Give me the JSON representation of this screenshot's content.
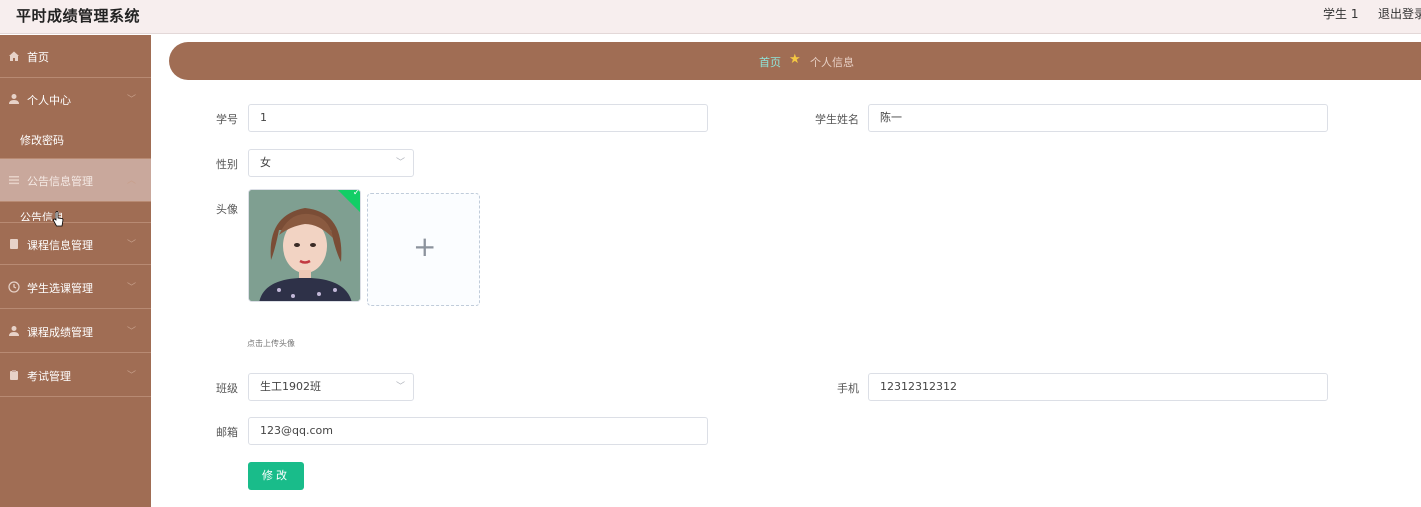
{
  "header": {
    "app_title": "平时成绩管理系统",
    "user_label": "学生 1",
    "logout_label": "退出登录"
  },
  "sidebar": {
    "items": [
      {
        "label": "首页",
        "icon": "home-icon",
        "has_chevron": false
      },
      {
        "label": "个人中心",
        "icon": "user-icon",
        "has_chevron": true
      },
      {
        "label": "修改密码",
        "sub": true
      },
      {
        "label": "公告信息管理",
        "icon": "menu-list-icon",
        "has_chevron": true,
        "active": true
      },
      {
        "label": "公告信息",
        "sub": true
      },
      {
        "label": "课程信息管理",
        "icon": "document-icon",
        "has_chevron": true
      },
      {
        "label": "学生选课管理",
        "icon": "clock-icon",
        "has_chevron": true
      },
      {
        "label": "课程成绩管理",
        "icon": "user-icon",
        "has_chevron": true
      },
      {
        "label": "考试管理",
        "icon": "clipboard-icon",
        "has_chevron": true
      }
    ]
  },
  "breadcrumb": {
    "home": "首页",
    "current": "个人信息"
  },
  "form": {
    "student_no_label": "学号",
    "student_no_value": "1",
    "student_name_label": "学生姓名",
    "student_name_value": "陈一",
    "gender_label": "性别",
    "gender_value": "女",
    "avatar_label": "头像",
    "upload_tip": "点击上传头像",
    "class_label": "班级",
    "class_value": "生工1902班",
    "phone_label": "手机",
    "phone_value": "12312312312",
    "email_label": "邮箱",
    "email_value": "123@qq.com",
    "submit_label": "修改"
  },
  "colors": {
    "sidebar_bg": "#a06d54",
    "active_item_bg": "#c9a89c",
    "header_bg": "#f7eeee",
    "primary_button": "#19bc8a",
    "breadcrumb_home": "#8fe3d8"
  }
}
